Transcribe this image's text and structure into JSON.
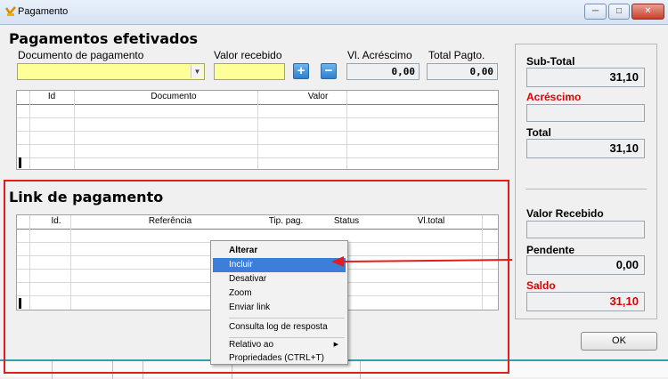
{
  "window": {
    "title": "Pagamento"
  },
  "pagamentos": {
    "heading": "Pagamentos efetivados",
    "doc_label": "Documento de pagamento",
    "doc_value": "",
    "valor_label": "Valor recebido",
    "valor_value": "",
    "acrescimo_label": "Vl. Acréscimo",
    "acrescimo_value": "0,00",
    "total_label": "Total Pagto.",
    "total_value": "0,00",
    "columns": [
      "Id",
      "Documento",
      "Valor"
    ]
  },
  "link": {
    "heading": "Link de pagamento",
    "columns": [
      "Id.",
      "Referência",
      "Tip. pag.",
      "Status",
      "Vl.total"
    ]
  },
  "summary": {
    "subtotal_label": "Sub-Total",
    "subtotal_value": "31,10",
    "acrescimo_label": "Acréscimo",
    "acrescimo_value": "",
    "total_label": "Total",
    "total_value": "31,10",
    "recebido_label": "Valor Recebido",
    "recebido_value": "",
    "pendente_label": "Pendente",
    "pendente_value": "0,00",
    "saldo_label": "Saldo",
    "saldo_value": "31,10"
  },
  "ok_label": "OK",
  "context_menu": {
    "items": [
      "Alterar",
      "Incluir",
      "Desativar",
      "Zoom",
      "Enviar link",
      "Consulta log de resposta",
      "Relativo ao",
      "Propriedades (CTRL+T)"
    ]
  },
  "colors": {
    "highlight": "#e51c1c",
    "menu_selected": "#3d7fd8",
    "input_yellow": "#ffff99"
  }
}
